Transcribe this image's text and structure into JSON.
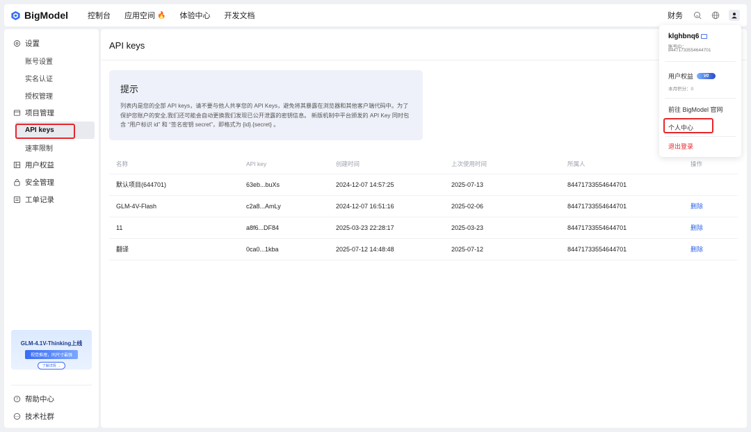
{
  "brand": {
    "name": "BigModel"
  },
  "nav": [
    {
      "label": "控制台"
    },
    {
      "label": "应用空间",
      "badge": "🔥"
    },
    {
      "label": "体验中心"
    },
    {
      "label": "开发文档"
    }
  ],
  "topbar_right": {
    "finance": "财务"
  },
  "sidebar": {
    "settings": "设置",
    "account_settings": "账号设置",
    "realname": "实名认证",
    "authorization": "授权管理",
    "project_mgmt": "项目管理",
    "api_keys": "API keys",
    "rate_limit": "速率限制",
    "user_benefits": "用户权益",
    "security": "安全管理",
    "tickets": "工单记录",
    "promo": {
      "title": "GLM-4.1V-Thinking上线",
      "tag": "视觉推理，同尺寸最强",
      "button": "了解详情 →"
    },
    "help": "帮助中心",
    "community": "技术社群"
  },
  "main": {
    "title": "API keys",
    "tip": {
      "title": "提示",
      "body": "列表内是您的全部 API keys，请不要与他人共享您的 API Keys，避免将其暴露在浏览器和其他客户端代码中。为了保护您账户的安全,我们还可能会自动更换我们发现已公开泄露的密钥信息。 新版机制中平台颁发的 API Key 同时包含 “用户标识 id” 和 “签名密钥 secret”，即格式为 {id}.{secret} 。"
    },
    "table": {
      "headers": [
        "名称",
        "API key",
        "创建时间",
        "上次使用时间",
        "所属人",
        "操作"
      ],
      "rows": [
        {
          "name": "默认项目(644701)",
          "key": "63eb...buXs",
          "created": "2024-12-07 14:57:25",
          "last_used": "2025-07-13",
          "owner": "84471733554644701",
          "action": ""
        },
        {
          "name": "GLM-4V-Flash",
          "key": "c2a8...AmLy",
          "created": "2024-12-07 16:51:16",
          "last_used": "2025-02-06",
          "owner": "84471733554644701",
          "action": "删除"
        },
        {
          "name": "11",
          "key": "a8f6...DF84",
          "created": "2025-03-23 22:28:17",
          "last_used": "2025-03-23",
          "owner": "84471733554644701",
          "action": "删除"
        },
        {
          "name": "翻译",
          "key": "0ca0...1kba",
          "created": "2025-07-12 14:48:48",
          "last_used": "2025-07-12",
          "owner": "84471733554644701",
          "action": "删除"
        }
      ]
    }
  },
  "dropdown": {
    "username": "klghbnq6",
    "uid_label": "账号ID：",
    "uid": "84471733554644701",
    "benefits": "用户权益",
    "level": "V0",
    "points": "本月积分：0",
    "official_site": "前往 BigModel 官网",
    "personal_center": "个人中心",
    "logout": "退出登录"
  },
  "colors": {
    "accent": "#2f63e8",
    "highlight": "#e5262b",
    "logout": "#e5262b"
  }
}
